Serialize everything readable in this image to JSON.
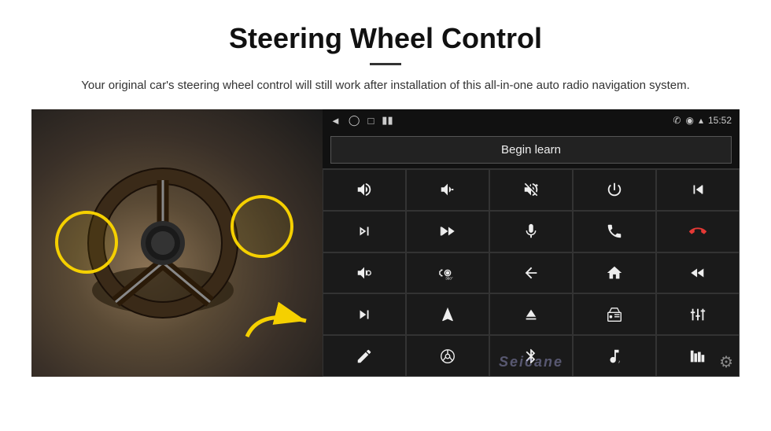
{
  "header": {
    "title": "Steering Wheel Control",
    "subtitle": "Your original car's steering wheel control will still work after installation of this all-in-one auto radio navigation system."
  },
  "screen": {
    "begin_learn_label": "Begin learn",
    "time": "15:52",
    "watermark": "Seicane"
  },
  "controls": [
    {
      "id": "vol-up",
      "icon": "vol-up"
    },
    {
      "id": "vol-down",
      "icon": "vol-down"
    },
    {
      "id": "mute",
      "icon": "mute"
    },
    {
      "id": "power",
      "icon": "power"
    },
    {
      "id": "prev-track-end",
      "icon": "prev-track-end"
    },
    {
      "id": "next-track",
      "icon": "next-track"
    },
    {
      "id": "fast-forward",
      "icon": "fast-forward"
    },
    {
      "id": "mic",
      "icon": "mic"
    },
    {
      "id": "phone",
      "icon": "phone"
    },
    {
      "id": "hang-up",
      "icon": "hang-up"
    },
    {
      "id": "speaker",
      "icon": "speaker"
    },
    {
      "id": "360",
      "icon": "360"
    },
    {
      "id": "back",
      "icon": "back"
    },
    {
      "id": "home",
      "icon": "home"
    },
    {
      "id": "skip-back",
      "icon": "skip-back"
    },
    {
      "id": "skip-fwd",
      "icon": "skip-fwd"
    },
    {
      "id": "navigate",
      "icon": "navigate"
    },
    {
      "id": "eject",
      "icon": "eject"
    },
    {
      "id": "radio",
      "icon": "radio"
    },
    {
      "id": "equalizer",
      "icon": "equalizer"
    },
    {
      "id": "pen",
      "icon": "pen"
    },
    {
      "id": "steering-ctrl",
      "icon": "steering-ctrl"
    },
    {
      "id": "bluetooth",
      "icon": "bluetooth"
    },
    {
      "id": "music",
      "icon": "music"
    },
    {
      "id": "bars",
      "icon": "bars"
    }
  ]
}
